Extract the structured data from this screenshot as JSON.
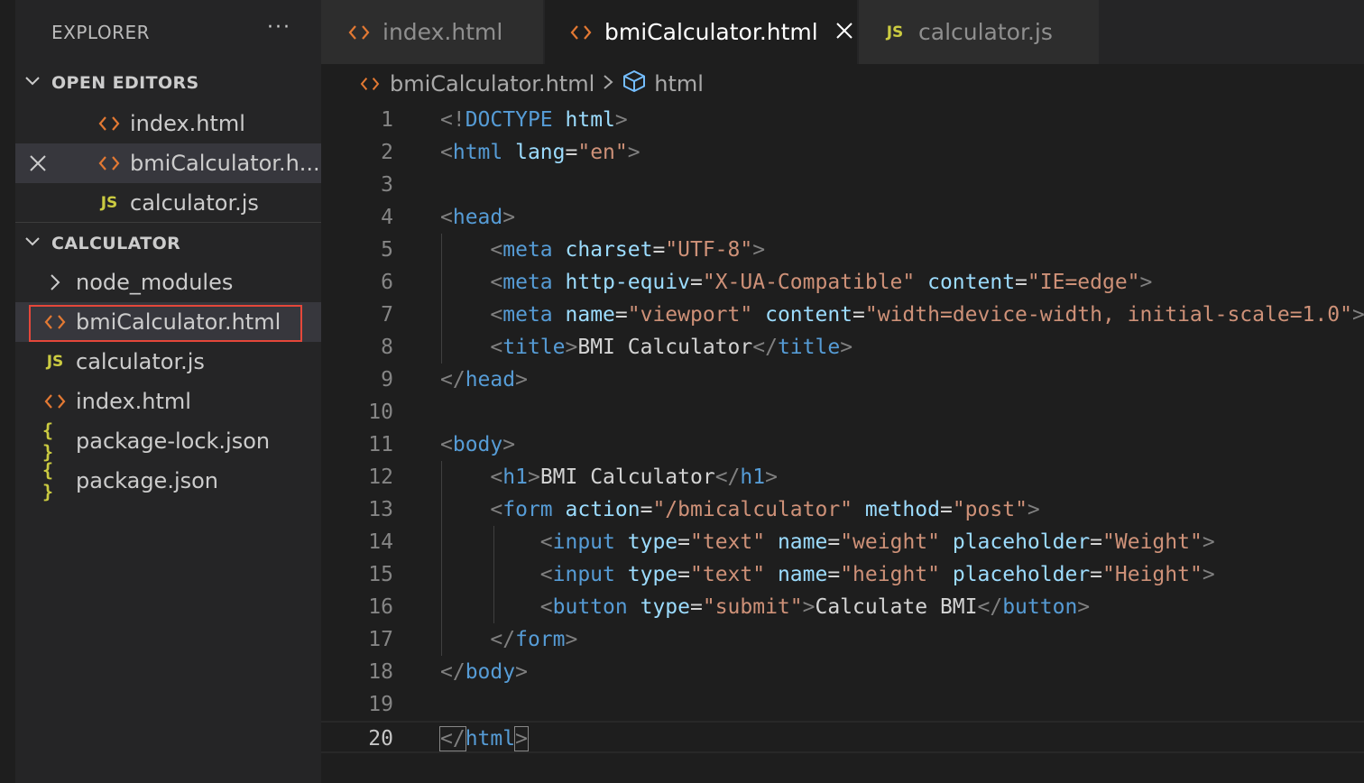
{
  "sidebar": {
    "title": "EXPLORER",
    "more": "···",
    "open_editors": {
      "title": "OPEN EDITORS",
      "items": [
        {
          "label": "index.html",
          "icon": "html-file-icon"
        },
        {
          "label": "bmiCalculator.h...",
          "icon": "html-file-icon",
          "active": true
        },
        {
          "label": "calculator.js",
          "icon": "js-file-icon"
        }
      ]
    },
    "folder": {
      "title": "CALCULATOR",
      "items": [
        {
          "label": "node_modules",
          "icon": "chevron-right-icon"
        },
        {
          "label": "bmiCalculator.html",
          "icon": "html-file-icon",
          "selected": true
        },
        {
          "label": "calculator.js",
          "icon": "js-file-icon"
        },
        {
          "label": "index.html",
          "icon": "html-file-icon"
        },
        {
          "label": "package-lock.json",
          "icon": "json-file-icon"
        },
        {
          "label": "package.json",
          "icon": "json-file-icon"
        }
      ]
    },
    "js_badge": "JS",
    "json_badge": "{ }"
  },
  "tabs": [
    {
      "label": "index.html",
      "icon": "html-file-icon"
    },
    {
      "label": "bmiCalculator.html",
      "icon": "html-file-icon",
      "active": true
    },
    {
      "label": "calculator.js",
      "icon": "js-file-icon"
    }
  ],
  "breadcrumb": {
    "file": "bmiCalculator.html",
    "symbol": "html"
  },
  "editor": {
    "current_line": 20,
    "lines": [
      {
        "n": "1",
        "tokens": [
          [
            "p",
            "<!"
          ],
          [
            "t",
            "DOCTYPE"
          ],
          [
            "x",
            " "
          ],
          [
            "a",
            "html"
          ],
          [
            "p",
            ">"
          ]
        ]
      },
      {
        "n": "2",
        "tokens": [
          [
            "p",
            "<"
          ],
          [
            "t",
            "html"
          ],
          [
            "x",
            " "
          ],
          [
            "a",
            "lang"
          ],
          [
            "x",
            "="
          ],
          [
            "s",
            "\"en\""
          ],
          [
            "p",
            ">"
          ]
        ]
      },
      {
        "n": "3",
        "tokens": []
      },
      {
        "n": "4",
        "tokens": [
          [
            "p",
            "<"
          ],
          [
            "t",
            "head"
          ],
          [
            "p",
            ">"
          ]
        ]
      },
      {
        "n": "5",
        "tokens": [
          [
            "x",
            "    "
          ],
          [
            "p",
            "<"
          ],
          [
            "t",
            "meta"
          ],
          [
            "x",
            " "
          ],
          [
            "a",
            "charset"
          ],
          [
            "x",
            "="
          ],
          [
            "s",
            "\"UTF-8\""
          ],
          [
            "p",
            ">"
          ]
        ]
      },
      {
        "n": "6",
        "tokens": [
          [
            "x",
            "    "
          ],
          [
            "p",
            "<"
          ],
          [
            "t",
            "meta"
          ],
          [
            "x",
            " "
          ],
          [
            "a",
            "http-equiv"
          ],
          [
            "x",
            "="
          ],
          [
            "s",
            "\"X-UA-Compatible\""
          ],
          [
            "x",
            " "
          ],
          [
            "a",
            "content"
          ],
          [
            "x",
            "="
          ],
          [
            "s",
            "\"IE=edge\""
          ],
          [
            "p",
            ">"
          ]
        ]
      },
      {
        "n": "7",
        "tokens": [
          [
            "x",
            "    "
          ],
          [
            "p",
            "<"
          ],
          [
            "t",
            "meta"
          ],
          [
            "x",
            " "
          ],
          [
            "a",
            "name"
          ],
          [
            "x",
            "="
          ],
          [
            "s",
            "\"viewport\""
          ],
          [
            "x",
            " "
          ],
          [
            "a",
            "content"
          ],
          [
            "x",
            "="
          ],
          [
            "s",
            "\"width=device-width, initial-scale=1.0\""
          ],
          [
            "p",
            ">"
          ]
        ]
      },
      {
        "n": "8",
        "tokens": [
          [
            "x",
            "    "
          ],
          [
            "p",
            "<"
          ],
          [
            "t",
            "title"
          ],
          [
            "p",
            ">"
          ],
          [
            "x",
            "BMI Calculator"
          ],
          [
            "p",
            "</"
          ],
          [
            "t",
            "title"
          ],
          [
            "p",
            ">"
          ]
        ]
      },
      {
        "n": "9",
        "tokens": [
          [
            "p",
            "</"
          ],
          [
            "t",
            "head"
          ],
          [
            "p",
            ">"
          ]
        ]
      },
      {
        "n": "10",
        "tokens": []
      },
      {
        "n": "11",
        "tokens": [
          [
            "p",
            "<"
          ],
          [
            "t",
            "body"
          ],
          [
            "p",
            ">"
          ]
        ]
      },
      {
        "n": "12",
        "tokens": [
          [
            "x",
            "    "
          ],
          [
            "p",
            "<"
          ],
          [
            "t",
            "h1"
          ],
          [
            "p",
            ">"
          ],
          [
            "x",
            "BMI Calculator"
          ],
          [
            "p",
            "</"
          ],
          [
            "t",
            "h1"
          ],
          [
            "p",
            ">"
          ]
        ]
      },
      {
        "n": "13",
        "tokens": [
          [
            "x",
            "    "
          ],
          [
            "p",
            "<"
          ],
          [
            "t",
            "form"
          ],
          [
            "x",
            " "
          ],
          [
            "a",
            "action"
          ],
          [
            "x",
            "="
          ],
          [
            "s",
            "\"/bmicalculator\""
          ],
          [
            "x",
            " "
          ],
          [
            "a",
            "method"
          ],
          [
            "x",
            "="
          ],
          [
            "s",
            "\"post\""
          ],
          [
            "p",
            ">"
          ]
        ]
      },
      {
        "n": "14",
        "tokens": [
          [
            "x",
            "        "
          ],
          [
            "p",
            "<"
          ],
          [
            "t",
            "input"
          ],
          [
            "x",
            " "
          ],
          [
            "a",
            "type"
          ],
          [
            "x",
            "="
          ],
          [
            "s",
            "\"text\""
          ],
          [
            "x",
            " "
          ],
          [
            "a",
            "name"
          ],
          [
            "x",
            "="
          ],
          [
            "s",
            "\"weight\""
          ],
          [
            "x",
            " "
          ],
          [
            "a",
            "placeholder"
          ],
          [
            "x",
            "="
          ],
          [
            "s",
            "\"Weight\""
          ],
          [
            "p",
            ">"
          ]
        ]
      },
      {
        "n": "15",
        "tokens": [
          [
            "x",
            "        "
          ],
          [
            "p",
            "<"
          ],
          [
            "t",
            "input"
          ],
          [
            "x",
            " "
          ],
          [
            "a",
            "type"
          ],
          [
            "x",
            "="
          ],
          [
            "s",
            "\"text\""
          ],
          [
            "x",
            " "
          ],
          [
            "a",
            "name"
          ],
          [
            "x",
            "="
          ],
          [
            "s",
            "\"height\""
          ],
          [
            "x",
            " "
          ],
          [
            "a",
            "placeholder"
          ],
          [
            "x",
            "="
          ],
          [
            "s",
            "\"Height\""
          ],
          [
            "p",
            ">"
          ]
        ]
      },
      {
        "n": "16",
        "tokens": [
          [
            "x",
            "        "
          ],
          [
            "p",
            "<"
          ],
          [
            "t",
            "button"
          ],
          [
            "x",
            " "
          ],
          [
            "a",
            "type"
          ],
          [
            "x",
            "="
          ],
          [
            "s",
            "\"submit\""
          ],
          [
            "p",
            ">"
          ],
          [
            "x",
            "Calculate BMI"
          ],
          [
            "p",
            "</"
          ],
          [
            "t",
            "button"
          ],
          [
            "p",
            ">"
          ]
        ]
      },
      {
        "n": "17",
        "tokens": [
          [
            "x",
            "    "
          ],
          [
            "p",
            "</"
          ],
          [
            "t",
            "form"
          ],
          [
            "p",
            ">"
          ]
        ]
      },
      {
        "n": "18",
        "tokens": [
          [
            "p",
            "</"
          ],
          [
            "t",
            "body"
          ],
          [
            "p",
            ">"
          ]
        ]
      },
      {
        "n": "19",
        "tokens": []
      },
      {
        "n": "20",
        "tokens": [
          [
            "p",
            "</"
          ],
          [
            "t",
            "html"
          ],
          [
            "p",
            ">"
          ]
        ]
      }
    ]
  },
  "colors": {
    "html_icon": "#e37933",
    "js_icon": "#cbcb41",
    "tag": "#569cd6",
    "attribute": "#9cdcfe",
    "string": "#ce9178",
    "punctuation": "#808080",
    "selection_border": "#e5473a"
  }
}
